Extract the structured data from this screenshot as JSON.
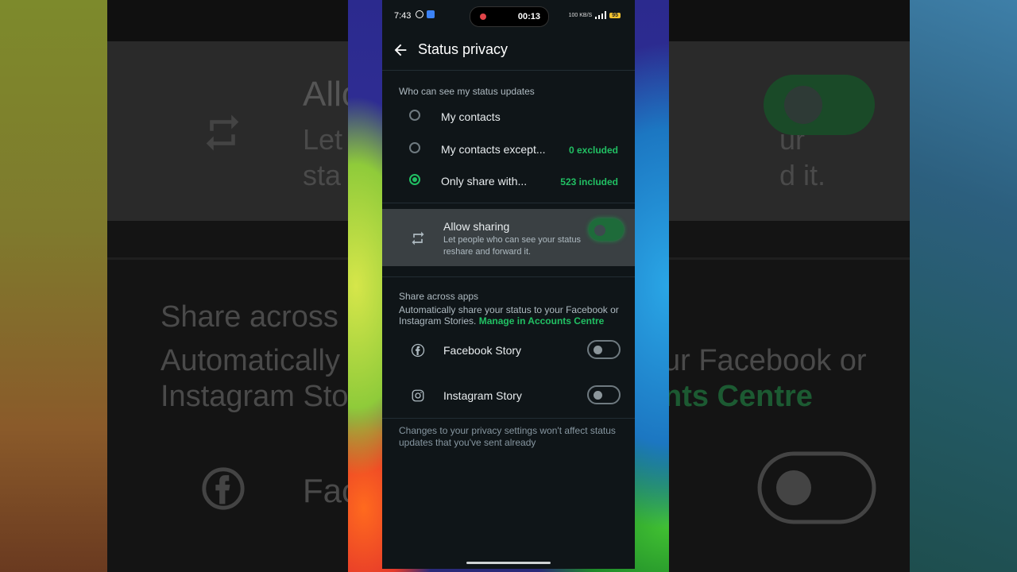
{
  "background": {
    "zoom_title": "Allo",
    "zoom_sub_1": "Let",
    "zoom_sub_1_right": "ur",
    "zoom_sub_2": "sta",
    "zoom_sub_2_right": "d it.",
    "zoom_share_heading": "Share across",
    "zoom_desc_1": "Automatically",
    "zoom_desc_1_right": "ur Facebook or",
    "zoom_desc_2": "Instagram Sto",
    "zoom_desc_2_right": "nts Centre",
    "zoom_fb_label": "Fac",
    "colors": {
      "accent": "#21c063",
      "panel": "#3a4043",
      "background": "#0f1518"
    }
  },
  "status_bar": {
    "time": "7:43",
    "record_timer": "00:13",
    "network_text": "100 KB/S",
    "battery": "95",
    "icons": [
      "whatsapp-icon",
      "gallery-icon",
      "record-dot-icon",
      "signal-icon",
      "battery-icon"
    ]
  },
  "appbar": {
    "title": "Status privacy",
    "back_icon": "arrow-left-icon"
  },
  "who_can_see": {
    "label": "Who can see my status updates",
    "options": [
      {
        "label": "My contacts",
        "meta": "",
        "selected": false
      },
      {
        "label": "My contacts except...",
        "meta": "0 excluded",
        "selected": false
      },
      {
        "label": "Only share with...",
        "meta": "523 included",
        "selected": true
      }
    ]
  },
  "allow_sharing": {
    "title": "Allow sharing",
    "subtitle": "Let people who can see your status reshare and forward it.",
    "enabled": true
  },
  "share_across_apps": {
    "label": "Share across apps",
    "description": "Automatically share your status to your Facebook or Instagram Stories.",
    "link": "Manage in Accounts Centre",
    "apps": [
      {
        "label": "Facebook Story",
        "icon": "facebook-icon",
        "enabled": false
      },
      {
        "label": "Instagram Story",
        "icon": "instagram-icon",
        "enabled": false
      }
    ]
  },
  "footer_note": "Changes to your privacy settings won't affect status updates that you've sent already"
}
